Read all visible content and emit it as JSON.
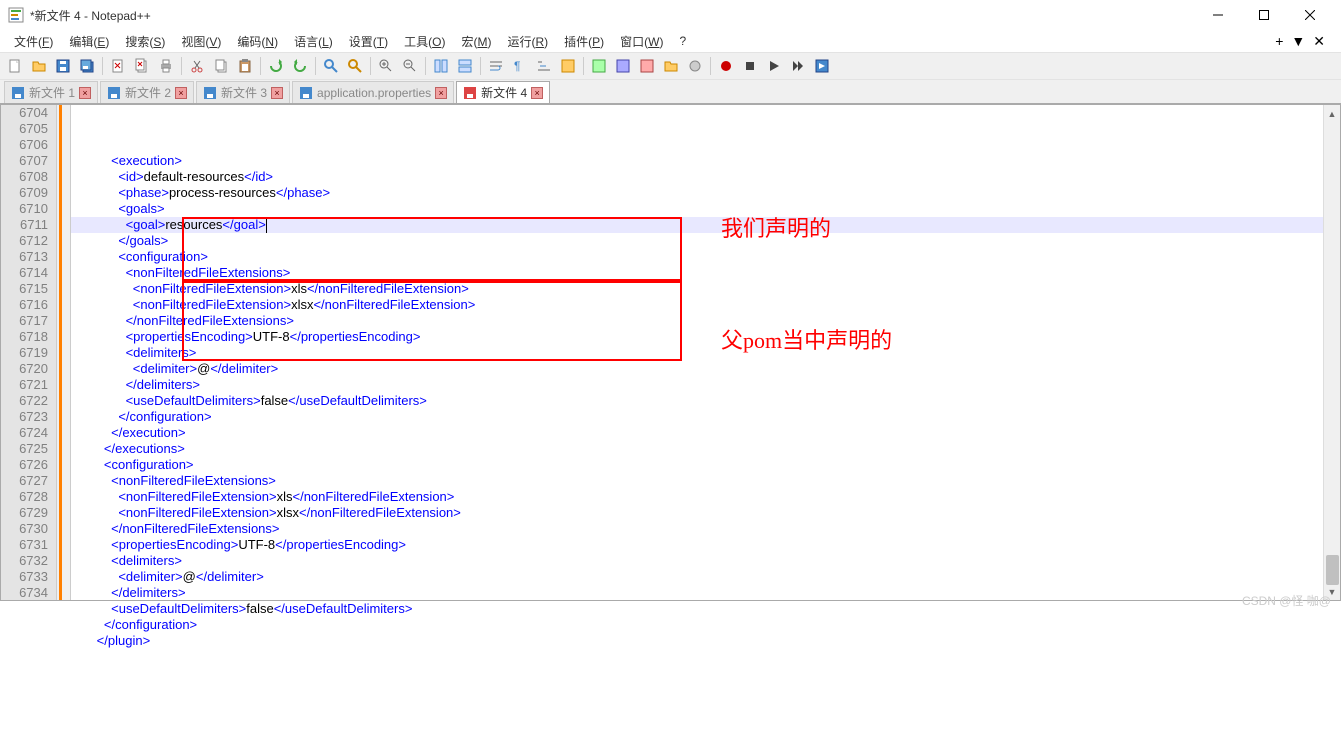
{
  "window": {
    "title": "*新文件 4 - Notepad++"
  },
  "menus": [
    {
      "label": "文件",
      "key": "F"
    },
    {
      "label": "编辑",
      "key": "E"
    },
    {
      "label": "搜索",
      "key": "S"
    },
    {
      "label": "视图",
      "key": "V"
    },
    {
      "label": "编码",
      "key": "N"
    },
    {
      "label": "语言",
      "key": "L"
    },
    {
      "label": "设置",
      "key": "T"
    },
    {
      "label": "工具",
      "key": "O"
    },
    {
      "label": "宏",
      "key": "M"
    },
    {
      "label": "运行",
      "key": "R"
    },
    {
      "label": "插件",
      "key": "P"
    },
    {
      "label": "窗口",
      "key": "W"
    },
    {
      "label": "?",
      "key": ""
    }
  ],
  "tabs": [
    {
      "label": "新文件 1",
      "active": false
    },
    {
      "label": "新文件 2",
      "active": false
    },
    {
      "label": "新文件 3",
      "active": false
    },
    {
      "label": "application.properties",
      "active": false
    },
    {
      "label": "新文件 4",
      "active": true
    }
  ],
  "editor": {
    "first_line_number": 6704,
    "highlighted_index": 4,
    "lines": [
      "          <execution>",
      "            <id>default-resources</id>",
      "            <phase>process-resources</phase>",
      "            <goals>",
      "              <goal>resources</goal>",
      "            </goals>",
      "            <configuration>",
      "              <nonFilteredFileExtensions>",
      "                <nonFilteredFileExtension>xls</nonFilteredFileExtension>",
      "                <nonFilteredFileExtension>xlsx</nonFilteredFileExtension>",
      "              </nonFilteredFileExtensions>",
      "              <propertiesEncoding>UTF-8</propertiesEncoding>",
      "              <delimiters>",
      "                <delimiter>@</delimiter>",
      "              </delimiters>",
      "              <useDefaultDelimiters>false</useDefaultDelimiters>",
      "            </configuration>",
      "          </execution>",
      "        </executions>",
      "        <configuration>",
      "          <nonFilteredFileExtensions>",
      "            <nonFilteredFileExtension>xls</nonFilteredFileExtension>",
      "            <nonFilteredFileExtension>xlsx</nonFilteredFileExtension>",
      "          </nonFilteredFileExtensions>",
      "          <propertiesEncoding>UTF-8</propertiesEncoding>",
      "          <delimiters>",
      "            <delimiter>@</delimiter>",
      "          </delimiters>",
      "          <useDefaultDelimiters>false</useDefaultDelimiters>",
      "        </configuration>",
      "      </plugin>"
    ]
  },
  "annotations": {
    "box1_label": "我们声明的",
    "box2_label": "父pom当中声明的"
  },
  "watermark": "CSDN @怪 咖@"
}
